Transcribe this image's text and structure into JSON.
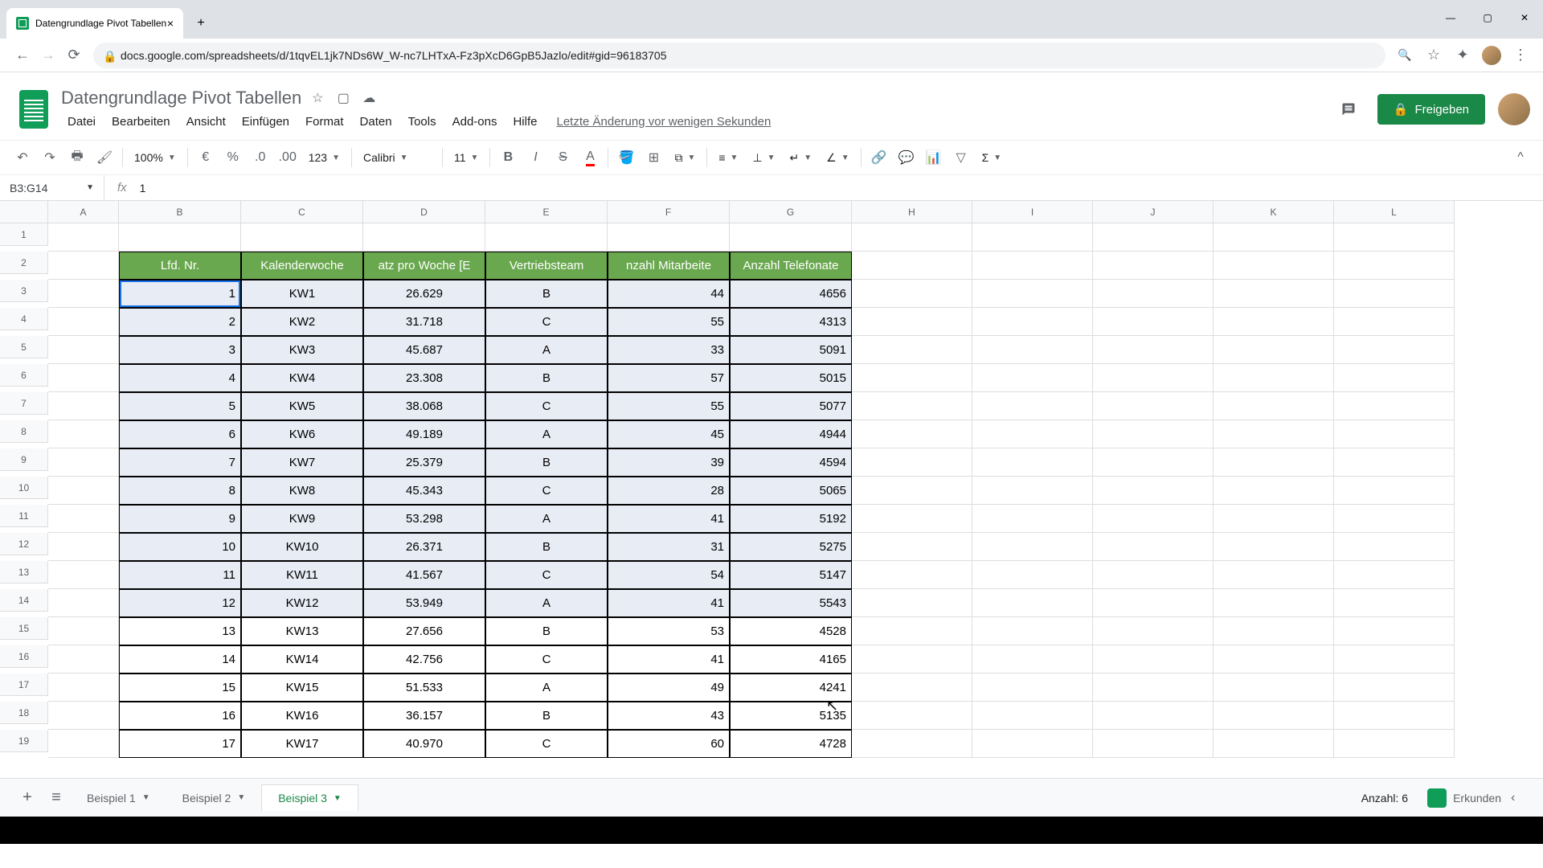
{
  "browser": {
    "tab_title": "Datengrundlage Pivot Tabellen",
    "url": "docs.google.com/spreadsheets/d/1tqvEL1jk7NDs6W_W-nc7LHTxA-Fz3pXcD6GpB5Jazlo/edit#gid=96183705"
  },
  "doc": {
    "title": "Datengrundlage Pivot Tabellen",
    "last_edit": "Letzte Änderung vor wenigen Sekunden"
  },
  "menu": {
    "datei": "Datei",
    "bearbeiten": "Bearbeiten",
    "ansicht": "Ansicht",
    "einfuegen": "Einfügen",
    "format": "Format",
    "daten": "Daten",
    "tools": "Tools",
    "addons": "Add-ons",
    "hilfe": "Hilfe"
  },
  "share": {
    "label": "Freigeben"
  },
  "toolbar": {
    "zoom": "100%",
    "currency": "€",
    "percent": "%",
    "num_fmt": "123",
    "font": "Calibri",
    "size": "11"
  },
  "namebox": {
    "ref": "B3:G14",
    "formula": "1"
  },
  "columns": [
    "A",
    "B",
    "C",
    "D",
    "E",
    "F",
    "G",
    "H",
    "I",
    "J",
    "K",
    "L"
  ],
  "headers": {
    "b": "Lfd. Nr.",
    "c": "Kalenderwoche",
    "d": "atz pro Woche [E",
    "e": "Vertriebsteam",
    "f": "nzahl Mitarbeite",
    "g": "Anzahl Telefonate"
  },
  "rows": [
    {
      "n": "1",
      "kw": "KW1",
      "u": "26.629",
      "t": "B",
      "m": "44",
      "tel": "4656"
    },
    {
      "n": "2",
      "kw": "KW2",
      "u": "31.718",
      "t": "C",
      "m": "55",
      "tel": "4313"
    },
    {
      "n": "3",
      "kw": "KW3",
      "u": "45.687",
      "t": "A",
      "m": "33",
      "tel": "5091"
    },
    {
      "n": "4",
      "kw": "KW4",
      "u": "23.308",
      "t": "B",
      "m": "57",
      "tel": "5015"
    },
    {
      "n": "5",
      "kw": "KW5",
      "u": "38.068",
      "t": "C",
      "m": "55",
      "tel": "5077"
    },
    {
      "n": "6",
      "kw": "KW6",
      "u": "49.189",
      "t": "A",
      "m": "45",
      "tel": "4944"
    },
    {
      "n": "7",
      "kw": "KW7",
      "u": "25.379",
      "t": "B",
      "m": "39",
      "tel": "4594"
    },
    {
      "n": "8",
      "kw": "KW8",
      "u": "45.343",
      "t": "C",
      "m": "28",
      "tel": "5065"
    },
    {
      "n": "9",
      "kw": "KW9",
      "u": "53.298",
      "t": "A",
      "m": "41",
      "tel": "5192"
    },
    {
      "n": "10",
      "kw": "KW10",
      "u": "26.371",
      "t": "B",
      "m": "31",
      "tel": "5275"
    },
    {
      "n": "11",
      "kw": "KW11",
      "u": "41.567",
      "t": "C",
      "m": "54",
      "tel": "5147"
    },
    {
      "n": "12",
      "kw": "KW12",
      "u": "53.949",
      "t": "A",
      "m": "41",
      "tel": "5543"
    },
    {
      "n": "13",
      "kw": "KW13",
      "u": "27.656",
      "t": "B",
      "m": "53",
      "tel": "4528"
    },
    {
      "n": "14",
      "kw": "KW14",
      "u": "42.756",
      "t": "C",
      "m": "41",
      "tel": "4165"
    },
    {
      "n": "15",
      "kw": "KW15",
      "u": "51.533",
      "t": "A",
      "m": "49",
      "tel": "4241"
    },
    {
      "n": "16",
      "kw": "KW16",
      "u": "36.157",
      "t": "B",
      "m": "43",
      "tel": "5135"
    },
    {
      "n": "17",
      "kw": "KW17",
      "u": "40.970",
      "t": "C",
      "m": "60",
      "tel": "4728"
    }
  ],
  "sheets": {
    "tab1": "Beispiel 1",
    "tab2": "Beispiel 2",
    "tab3": "Beispiel 3"
  },
  "status": {
    "count": "Anzahl: 6",
    "explore": "Erkunden"
  }
}
